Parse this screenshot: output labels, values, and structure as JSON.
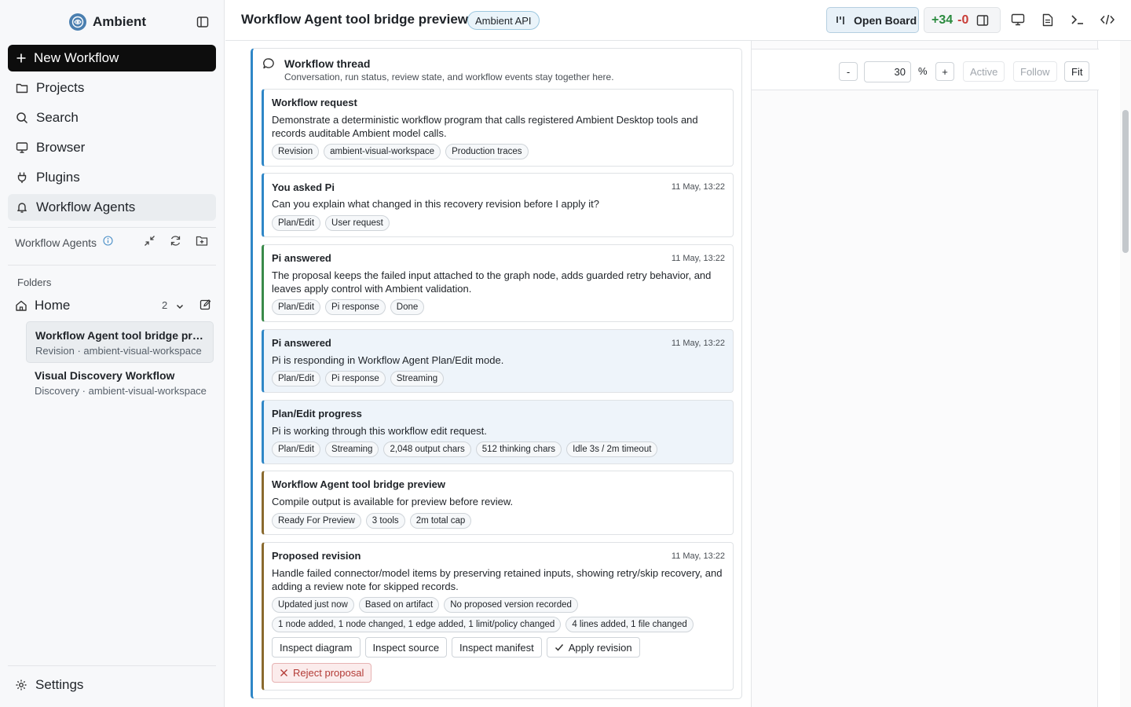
{
  "app": {
    "name": "Ambient"
  },
  "sidebar": {
    "new_workflow": "New Workflow",
    "nav": [
      {
        "label": "Projects",
        "icon": "folder-icon"
      },
      {
        "label": "Search",
        "icon": "search-icon"
      },
      {
        "label": "Browser",
        "icon": "monitor-icon"
      },
      {
        "label": "Plugins",
        "icon": "plug-icon"
      },
      {
        "label": "Workflow Agents",
        "icon": "bell-icon",
        "active": true
      }
    ],
    "section_title": "Workflow Agents",
    "folders_label": "Folders",
    "home": {
      "label": "Home",
      "count": "2"
    },
    "workflows": [
      {
        "title": "Workflow Agent tool bridge preview",
        "subtitle": "Revision · ambient-visual-workspace",
        "selected": true
      },
      {
        "title": "Visual Discovery Workflow",
        "subtitle": "Discovery · ambient-visual-workspace",
        "selected": false
      }
    ],
    "settings": "Settings"
  },
  "topbar": {
    "title": "Workflow Agent tool bridge preview",
    "badge": "Ambient API",
    "open_board": "Open Board",
    "diff_add": "+34",
    "diff_del": "-0"
  },
  "thread": {
    "title": "Workflow thread",
    "subtitle": "Conversation, run status, review state, and workflow events stay together here.",
    "cards": [
      {
        "title": "Workflow request",
        "time": "",
        "body": "Demonstrate a deterministic workflow program that calls registered Ambient Desktop tools and records auditable Ambient model calls.",
        "chips": [
          "Revision",
          "ambient-visual-workspace",
          "Production traces"
        ]
      },
      {
        "title": "You asked Pi",
        "time": "11 May, 13:22",
        "body": "Can you explain what changed in this recovery revision before I apply it?",
        "chips": [
          "Plan/Edit",
          "User request"
        ]
      },
      {
        "title": "Pi answered",
        "time": "11 May, 13:22",
        "body": "The proposal keeps the failed input attached to the graph node, adds guarded retry behavior, and leaves apply control with Ambient validation.",
        "chips": [
          "Plan/Edit",
          "Pi response",
          "Done"
        ]
      },
      {
        "title": "Pi answered",
        "time": "11 May, 13:22",
        "body": "Pi is responding in Workflow Agent Plan/Edit mode.",
        "chips": [
          "Plan/Edit",
          "Pi response",
          "Streaming"
        ]
      },
      {
        "title": "Plan/Edit progress",
        "time": "",
        "body": "Pi is working through this workflow edit request.",
        "chips": [
          "Plan/Edit",
          "Streaming",
          "2,048 output chars",
          "512 thinking chars",
          "Idle 3s / 2m timeout"
        ]
      },
      {
        "title": "Workflow Agent tool bridge preview",
        "time": "",
        "body": "Compile output is available for preview before review.",
        "chips": [
          "Ready For Preview",
          "3 tools",
          "2m total cap"
        ]
      },
      {
        "title": "Proposed revision",
        "time": "11 May, 13:22",
        "body": "Handle failed connector/model items by preserving retained inputs, showing retry/skip recovery, and adding a review note for skipped records.",
        "chips": [
          "Updated just now",
          "Based on artifact",
          "No proposed version recorded"
        ],
        "chips2": [
          "1 node added, 1 node changed, 1 edge added, 1 limit/policy changed",
          "4 lines added, 1 file changed"
        ],
        "buttons": [
          "Inspect diagram",
          "Inspect source",
          "Inspect manifest",
          "Apply revision"
        ],
        "reject": "Reject proposal"
      }
    ]
  },
  "canvas": {
    "zoom_minus": "-",
    "zoom_value": "30",
    "zoom_unit": "%",
    "zoom_plus": "+",
    "active": "Active",
    "follow": "Follow",
    "fit": "Fit"
  }
}
